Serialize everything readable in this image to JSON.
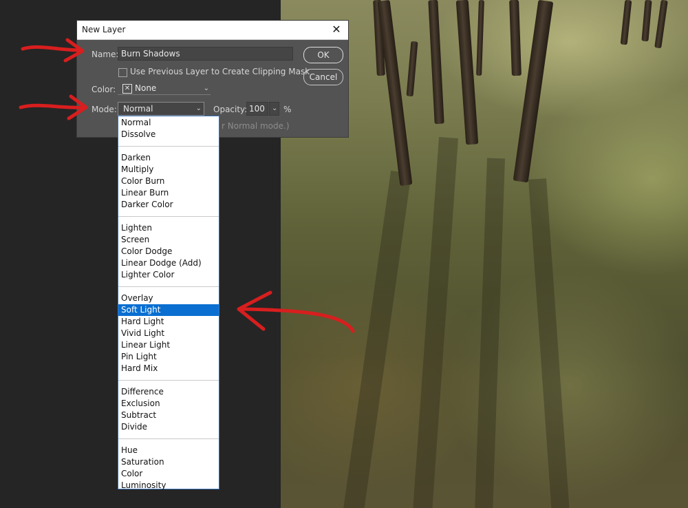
{
  "dialog": {
    "title": "New Layer",
    "name_label": "Name:",
    "name_value": "Burn Shadows",
    "clipping_label": "Use Previous Layer to Create Clipping Mask",
    "clipping_checked": false,
    "color_label": "Color:",
    "color_value": "None",
    "mode_label": "Mode:",
    "mode_value": "Normal",
    "opacity_label": "Opacity:",
    "opacity_value": "100",
    "opacity_unit": "%",
    "hint_text": "r Normal mode.)",
    "ok_label": "OK",
    "cancel_label": "Cancel"
  },
  "mode_options": [
    {
      "label": "Normal",
      "group": 0
    },
    {
      "label": "Dissolve",
      "group": 0
    },
    {
      "label": "Darken",
      "group": 1
    },
    {
      "label": "Multiply",
      "group": 1
    },
    {
      "label": "Color Burn",
      "group": 1
    },
    {
      "label": "Linear Burn",
      "group": 1
    },
    {
      "label": "Darker Color",
      "group": 1
    },
    {
      "label": "Lighten",
      "group": 2
    },
    {
      "label": "Screen",
      "group": 2
    },
    {
      "label": "Color Dodge",
      "group": 2
    },
    {
      "label": "Linear Dodge (Add)",
      "group": 2
    },
    {
      "label": "Lighter Color",
      "group": 2
    },
    {
      "label": "Overlay",
      "group": 3
    },
    {
      "label": "Soft Light",
      "group": 3,
      "selected": true
    },
    {
      "label": "Hard Light",
      "group": 3
    },
    {
      "label": "Vivid Light",
      "group": 3
    },
    {
      "label": "Linear Light",
      "group": 3
    },
    {
      "label": "Pin Light",
      "group": 3
    },
    {
      "label": "Hard Mix",
      "group": 3
    },
    {
      "label": "Difference",
      "group": 4
    },
    {
      "label": "Exclusion",
      "group": 4
    },
    {
      "label": "Subtract",
      "group": 4
    },
    {
      "label": "Divide",
      "group": 4
    },
    {
      "label": "Hue",
      "group": 5
    },
    {
      "label": "Saturation",
      "group": 5
    },
    {
      "label": "Color",
      "group": 5
    },
    {
      "label": "Luminosity",
      "group": 5
    }
  ],
  "colors": {
    "annotation": "#d81e1e",
    "dialog_bg": "#535353",
    "selection": "#0a6fd1"
  },
  "icons": [
    "close-icon",
    "color-none-icon",
    "chevron-down-icon",
    "checkbox-icon"
  ]
}
